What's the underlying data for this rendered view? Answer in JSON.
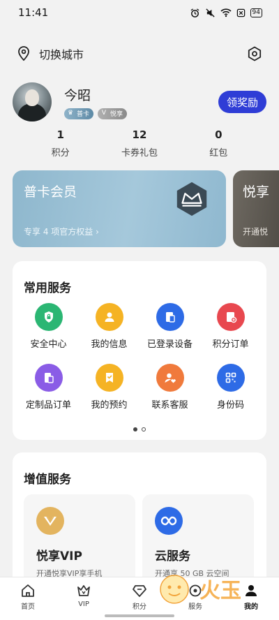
{
  "status": {
    "time": "11:41",
    "battery": "94"
  },
  "topbar": {
    "city_label": "切换城市"
  },
  "profile": {
    "username": "今昭",
    "badges": [
      "普卡",
      "悦享"
    ],
    "reward_button": "领奖励"
  },
  "stats": [
    {
      "value": "1",
      "label": "积分"
    },
    {
      "value": "12",
      "label": "卡券礼包"
    },
    {
      "value": "0",
      "label": "红包"
    }
  ],
  "member_cards": [
    {
      "title": "普卡会员",
      "subtitle": "专享 4 项官方权益 ›"
    },
    {
      "title": "悦享",
      "subtitle": "开通悦"
    }
  ],
  "common_services": {
    "title": "常用服务",
    "items": [
      {
        "label": "安全中心",
        "icon": "shield-lock-icon",
        "color": "#2bb673"
      },
      {
        "label": "我的信息",
        "icon": "user-icon",
        "color": "#f5b324"
      },
      {
        "label": "已登录设备",
        "icon": "devices-icon",
        "color": "#2e6be6"
      },
      {
        "label": "积分订单",
        "icon": "points-order-icon",
        "color": "#e8484f"
      },
      {
        "label": "定制品订单",
        "icon": "custom-order-icon",
        "color": "#8a5ce6"
      },
      {
        "label": "我的预约",
        "icon": "bookmark-check-icon",
        "color": "#f5b324"
      },
      {
        "label": "联系客服",
        "icon": "customer-service-icon",
        "color": "#f07a3c"
      },
      {
        "label": "身份码",
        "icon": "qr-code-icon",
        "color": "#2e6be6"
      }
    ]
  },
  "value_added": {
    "title": "增值服务",
    "items": [
      {
        "title": "悦享VIP",
        "subtitle": "开通悦享VIP享手机",
        "icon": "vip-crown-icon",
        "color": "#e3b45f"
      },
      {
        "title": "云服务",
        "subtitle": "开通享 50 GB 云空间",
        "icon": "cloud-infinity-icon",
        "color": "#2e6be6"
      }
    ]
  },
  "bottom_nav": [
    {
      "label": "首页",
      "icon": "home-icon"
    },
    {
      "label": "VIP",
      "icon": "vip-icon"
    },
    {
      "label": "积分",
      "icon": "diamond-icon"
    },
    {
      "label": "服务",
      "icon": "service-icon"
    },
    {
      "label": "我的",
      "icon": "me-icon"
    }
  ],
  "watermark": {
    "text": "火玉"
  }
}
